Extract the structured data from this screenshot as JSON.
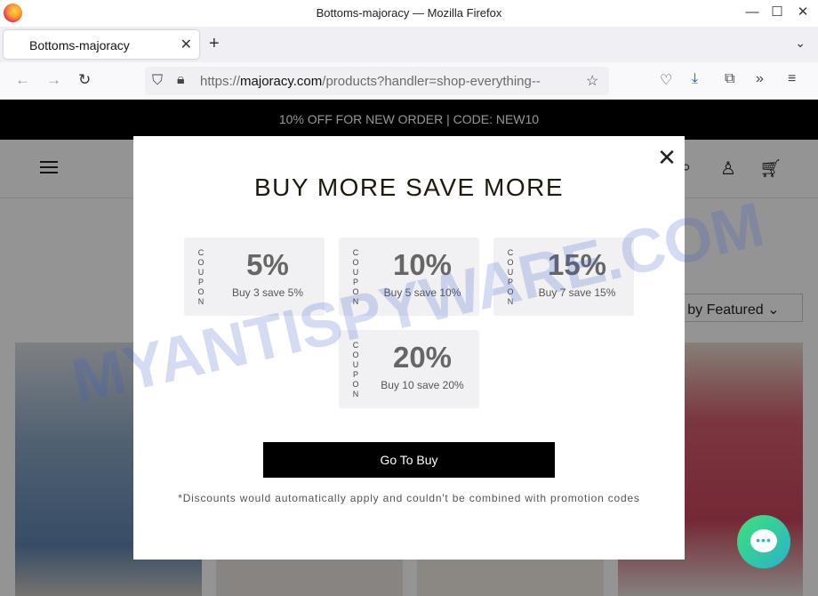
{
  "window": {
    "title": "Bottoms-majoracy — Mozilla Firefox"
  },
  "tab": {
    "label": "Bottoms-majoracy"
  },
  "url": {
    "prefix": "https://",
    "domain": "majoracy.com",
    "path": "/products?handler=shop-everything--"
  },
  "promo_bar": {
    "text": "10% OFF FOR NEW ORDER | CODE: NEW10"
  },
  "sort": {
    "label": "rt by",
    "value": "Featured"
  },
  "modal": {
    "title": "BUY MORE SAVE MORE",
    "coupons": [
      {
        "side": "COUPON",
        "percent": "5%",
        "desc": "Buy 3 save 5%"
      },
      {
        "side": "COUPON",
        "percent": "10%",
        "desc": "Buy 5 save 10%"
      },
      {
        "side": "COUPON",
        "percent": "15%",
        "desc": "Buy 7 save 15%"
      },
      {
        "side": "COUPON",
        "percent": "20%",
        "desc": "Buy 10 save 20%"
      }
    ],
    "button": "Go To Buy",
    "note": "*Discounts would automatically apply and couldn't be combined with promotion codes"
  },
  "watermark": "MYANTISPYWARE.COM",
  "colors": {
    "promo_bg": "#000000",
    "chat_start": "#3de07a",
    "chat_end": "#2bb3c9"
  },
  "icons": [
    "firefox-logo-icon",
    "back-icon",
    "forward-icon",
    "reload-icon",
    "shield-icon",
    "lock-icon",
    "star-icon",
    "pocket-icon",
    "download-icon",
    "extensions-icon",
    "more-tools-icon",
    "menu-icon",
    "search-icon",
    "account-icon",
    "cart-icon",
    "chat-icon"
  ]
}
